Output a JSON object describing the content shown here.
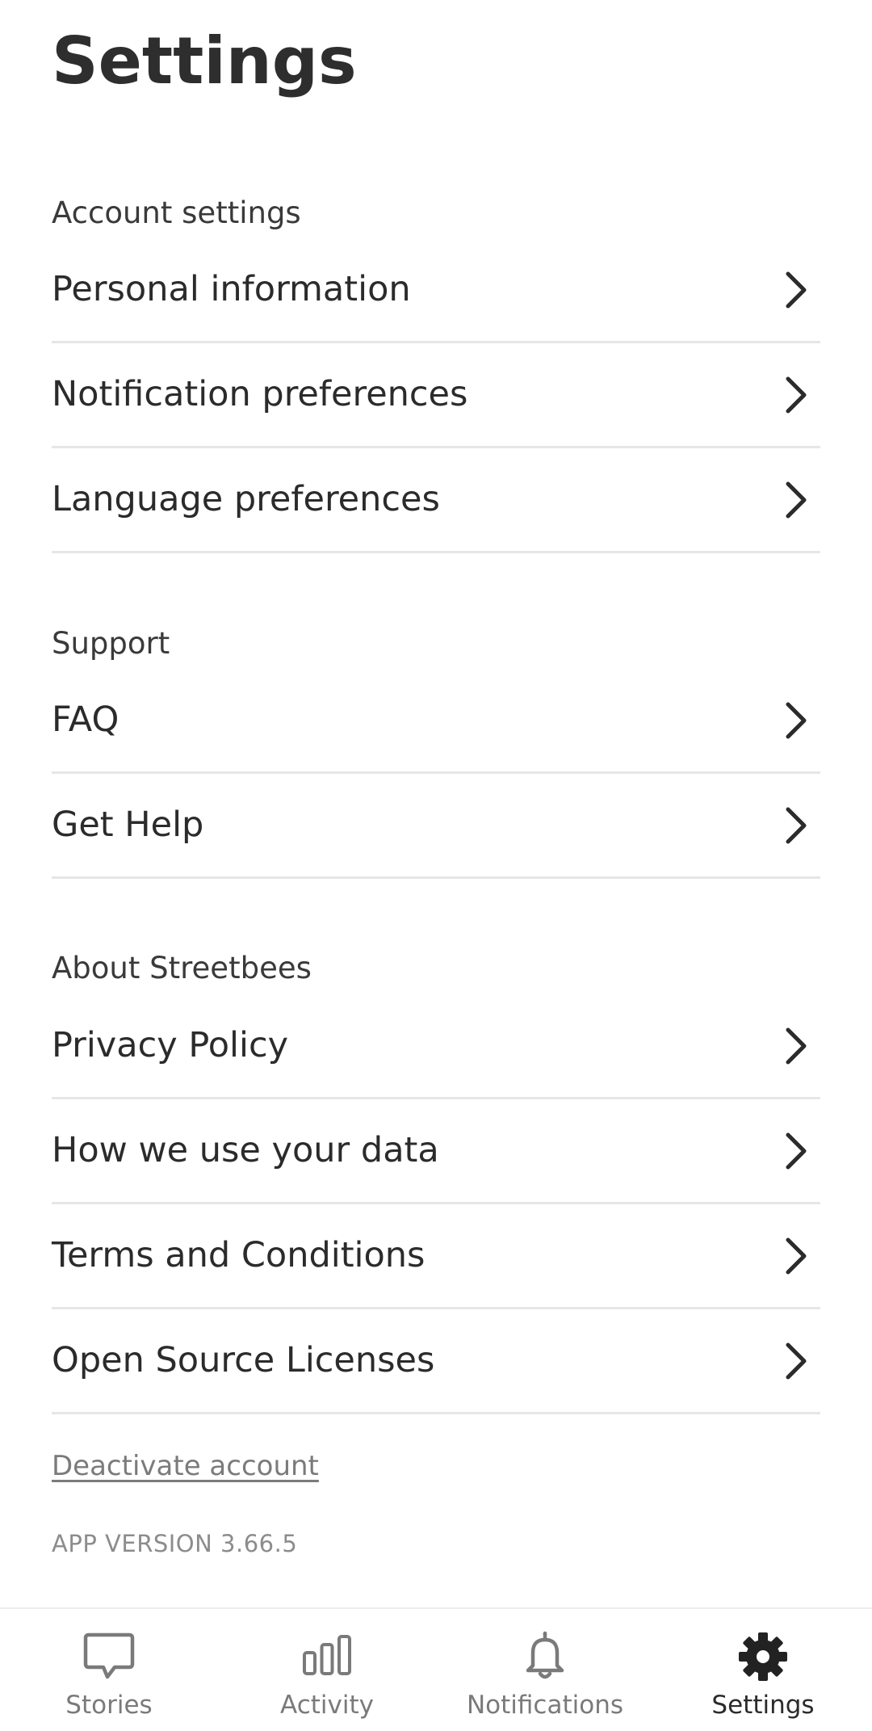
{
  "page": {
    "title": "Settings"
  },
  "sections": {
    "account": {
      "title": "Account settings",
      "items": [
        {
          "label": "Personal information"
        },
        {
          "label": "Notification preferences"
        },
        {
          "label": "Language preferences"
        }
      ]
    },
    "support": {
      "title": "Support",
      "items": [
        {
          "label": "FAQ"
        },
        {
          "label": "Get Help"
        }
      ]
    },
    "about": {
      "title": "About Streetbees",
      "items": [
        {
          "label": "Privacy Policy"
        },
        {
          "label": "How we use your data"
        },
        {
          "label": "Terms and Conditions"
        },
        {
          "label": "Open Source Licenses"
        }
      ]
    }
  },
  "footer": {
    "deactivate_label": "Deactivate account",
    "app_version": "APP VERSION 3.66.5"
  },
  "bottom_nav": {
    "active": "Settings",
    "items": [
      {
        "label": "Stories",
        "icon": "chat-bubble-icon"
      },
      {
        "label": "Activity",
        "icon": "bar-chart-icon"
      },
      {
        "label": "Notifications",
        "icon": "bell-icon"
      },
      {
        "label": "Settings",
        "icon": "gear-icon"
      }
    ]
  },
  "colors": {
    "text": "#2b2b2b",
    "muted": "#7a7a7a",
    "divider": "#e6e6e6",
    "background": "#ffffff"
  }
}
